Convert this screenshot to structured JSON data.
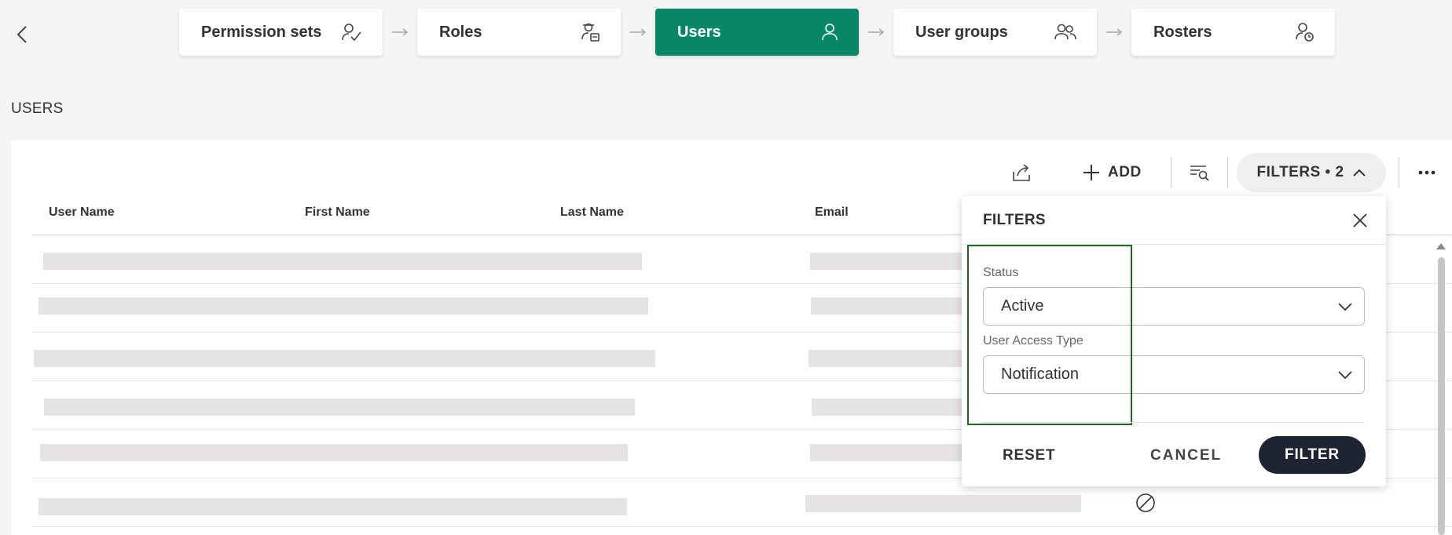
{
  "stepper": {
    "steps": [
      {
        "label": "Permission sets",
        "icon": "permission-check-icon"
      },
      {
        "label": "Roles",
        "icon": "role-badge-icon"
      },
      {
        "label": "Users",
        "icon": "user-icon"
      },
      {
        "label": "User groups",
        "icon": "user-group-icon"
      },
      {
        "label": "Rosters",
        "icon": "roster-icon"
      }
    ],
    "active_index": 2
  },
  "page": {
    "title": "USERS"
  },
  "toolbar": {
    "add_label": "ADD",
    "filters_label": "FILTERS • 2"
  },
  "table": {
    "columns": [
      "User Name",
      "First Name",
      "Last Name",
      "Email"
    ]
  },
  "filters_panel": {
    "title": "FILTERS",
    "status_label": "Status",
    "status_value": "Active",
    "access_label": "User Access Type",
    "access_value": "Notification",
    "reset_label": "RESET",
    "cancel_label": "CANCEL",
    "filter_label": "FILTER"
  },
  "colors": {
    "accent": "#078767",
    "primary_button": "#1f2433",
    "highlight_border": "#1e6b1e"
  }
}
